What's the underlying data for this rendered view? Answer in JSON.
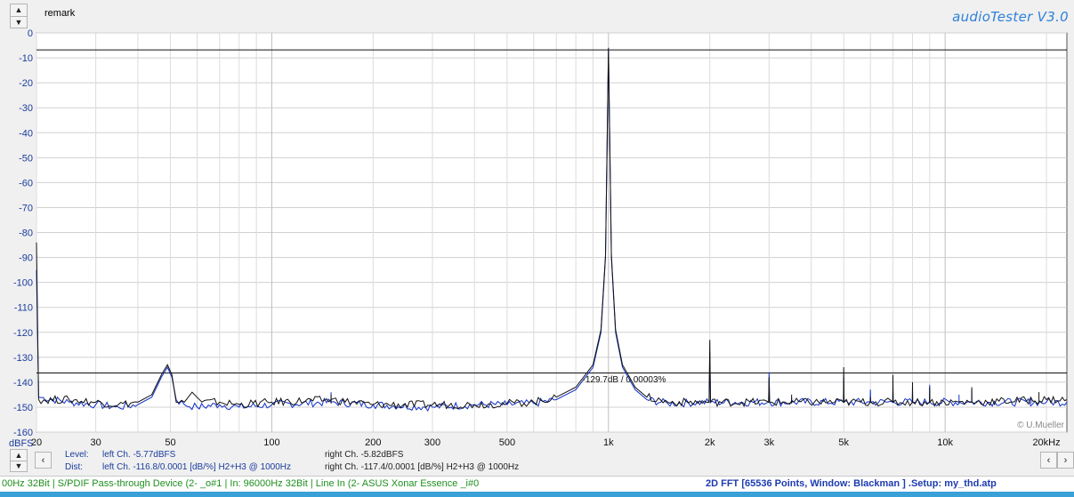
{
  "header": {
    "remark_label": "remark",
    "brand_title": "audioTester  V3.0"
  },
  "chart_data": {
    "type": "line",
    "title": "",
    "xlabel": "",
    "ylabel": "dBFS",
    "x_scale": "log",
    "xlim": [
      20,
      23000
    ],
    "ylim": [
      -160,
      0
    ],
    "grid": true,
    "y_ticks": [
      "0",
      "-10",
      "-20",
      "-30",
      "-40",
      "-50",
      "-60",
      "-70",
      "-80",
      "-90",
      "-100",
      "-110",
      "-120",
      "-130",
      "-140",
      "-150",
      "-160"
    ],
    "y_tick_values": [
      0,
      -10,
      -20,
      -30,
      -40,
      -50,
      -60,
      -70,
      -80,
      -90,
      -100,
      -110,
      -120,
      -130,
      -140,
      -150,
      -160
    ],
    "x_ticks": [
      {
        "v": 20,
        "label": "20"
      },
      {
        "v": 30,
        "label": "30"
      },
      {
        "v": 50,
        "label": "50"
      },
      {
        "v": 100,
        "label": "100"
      },
      {
        "v": 200,
        "label": "200"
      },
      {
        "v": 300,
        "label": "300"
      },
      {
        "v": 500,
        "label": "500"
      },
      {
        "v": 1000,
        "label": "1k"
      },
      {
        "v": 2000,
        "label": "2k"
      },
      {
        "v": 3000,
        "label": "3k"
      },
      {
        "v": 5000,
        "label": "5k"
      },
      {
        "v": 10000,
        "label": "10k"
      },
      {
        "v": 20000,
        "label": "20kHz"
      }
    ],
    "ref_levels": [
      -6.8,
      -136.3
    ],
    "annotation": "-129.7dB / 0.00003%",
    "annotation_at": {
      "x": 900,
      "y": -139
    },
    "copyright": "© U.Mueller",
    "series": [
      {
        "color": "#1030c8",
        "noise_floor": -148.5,
        "points": [
          [
            20,
            -95
          ],
          [
            20.3,
            -146
          ],
          [
            25,
            -148
          ],
          [
            30,
            -149
          ],
          [
            35,
            -150
          ],
          [
            40,
            -149
          ],
          [
            44,
            -146
          ],
          [
            47,
            -138
          ],
          [
            49,
            -134
          ],
          [
            50.5,
            -138
          ],
          [
            52,
            -147
          ],
          [
            55,
            -149
          ],
          [
            60,
            -150
          ],
          [
            70,
            -149
          ],
          [
            80,
            -150
          ],
          [
            100,
            -149
          ],
          [
            150,
            -148
          ],
          [
            200,
            -149
          ],
          [
            300,
            -150
          ],
          [
            400,
            -149
          ],
          [
            500,
            -149
          ],
          [
            600,
            -148.5
          ],
          [
            700,
            -147
          ],
          [
            800,
            -143
          ],
          [
            900,
            -134
          ],
          [
            950,
            -120
          ],
          [
            980,
            -90
          ],
          [
            1000,
            -7
          ],
          [
            1020,
            -90
          ],
          [
            1050,
            -120
          ],
          [
            1100,
            -134
          ],
          [
            1200,
            -143
          ],
          [
            1300,
            -147
          ],
          [
            1500,
            -148.5
          ],
          [
            1990,
            -148
          ],
          [
            2000,
            -128
          ],
          [
            2010,
            -148
          ],
          [
            2990,
            -148
          ],
          [
            3000,
            -136
          ],
          [
            3010,
            -148
          ],
          [
            4990,
            -148
          ],
          [
            5000,
            -138
          ],
          [
            5010,
            -148
          ],
          [
            5990,
            -148
          ],
          [
            6000,
            -143
          ],
          [
            6010,
            -148
          ],
          [
            6990,
            -148
          ],
          [
            7000,
            -142
          ],
          [
            7010,
            -148
          ],
          [
            7990,
            -148
          ],
          [
            8000,
            -143
          ],
          [
            8010,
            -148
          ],
          [
            8990,
            -148
          ],
          [
            9000,
            -141
          ],
          [
            9010,
            -148
          ],
          [
            11990,
            -148
          ],
          [
            12000,
            -143
          ],
          [
            12010,
            -148
          ],
          [
            20000,
            -148
          ],
          [
            23000,
            -148
          ]
        ],
        "spikes": [
          [
            150,
            -144
          ],
          [
            3500,
            -146
          ],
          [
            11000,
            -145
          ],
          [
            18000,
            -146
          ]
        ]
      },
      {
        "color": "#111111",
        "noise_floor": -148.5,
        "points": [
          [
            20,
            -84
          ],
          [
            20.3,
            -147
          ],
          [
            25,
            -147
          ],
          [
            30,
            -148
          ],
          [
            35,
            -149
          ],
          [
            40,
            -148
          ],
          [
            44,
            -145
          ],
          [
            47,
            -137
          ],
          [
            49,
            -133
          ],
          [
            50.5,
            -137
          ],
          [
            52,
            -148
          ],
          [
            55,
            -148
          ],
          [
            58,
            -144
          ],
          [
            62,
            -148
          ],
          [
            70,
            -148
          ],
          [
            80,
            -149
          ],
          [
            100,
            -148
          ],
          [
            150,
            -147
          ],
          [
            200,
            -149
          ],
          [
            300,
            -149
          ],
          [
            400,
            -149
          ],
          [
            500,
            -148.5
          ],
          [
            600,
            -148
          ],
          [
            700,
            -146
          ],
          [
            800,
            -142
          ],
          [
            900,
            -133
          ],
          [
            950,
            -119
          ],
          [
            980,
            -89
          ],
          [
            1000,
            -6
          ],
          [
            1020,
            -89
          ],
          [
            1050,
            -119
          ],
          [
            1100,
            -133
          ],
          [
            1200,
            -142
          ],
          [
            1300,
            -146
          ],
          [
            1500,
            -148
          ],
          [
            1990,
            -148
          ],
          [
            2000,
            -123
          ],
          [
            2010,
            -148
          ],
          [
            2990,
            -148
          ],
          [
            3000,
            -138
          ],
          [
            3010,
            -148
          ],
          [
            4990,
            -148
          ],
          [
            5000,
            -134
          ],
          [
            5010,
            -148
          ],
          [
            5990,
            -148
          ],
          [
            6000,
            -146
          ],
          [
            6010,
            -148
          ],
          [
            6990,
            -148
          ],
          [
            7000,
            -137
          ],
          [
            7010,
            -148
          ],
          [
            7990,
            -148
          ],
          [
            8000,
            -140
          ],
          [
            8010,
            -148
          ],
          [
            8990,
            -148
          ],
          [
            9000,
            -142
          ],
          [
            9010,
            -148
          ],
          [
            11990,
            -148
          ],
          [
            12000,
            -142
          ],
          [
            12010,
            -148
          ],
          [
            20000,
            -147
          ],
          [
            23000,
            -147
          ]
        ],
        "spikes": [
          [
            150,
            -145
          ],
          [
            3500,
            -145
          ],
          [
            19000,
            -144
          ]
        ]
      }
    ]
  },
  "info": {
    "level_label": "Level:",
    "dist_label": "Dist:",
    "level_left": "left Ch. -5.77dBFS",
    "level_right": "right Ch. -5.82dBFS",
    "dist_left": "left Ch. -116.8/0.0001 [dB/%] H2+H3 @ 1000Hz",
    "dist_right": "right Ch. -117.4/0.0001 [dB/%] H2+H3 @ 1000Hz"
  },
  "status": {
    "left": "00Hz 32Bit  | S/PDIF Pass-through Device (2- _o#1  | In: 96000Hz 32Bit  | Line In (2- ASUS Xonar Essence _i#0",
    "right": "2D FFT [65536 Points, Window: Blackman ]  .Setup: my_thd.atp"
  }
}
